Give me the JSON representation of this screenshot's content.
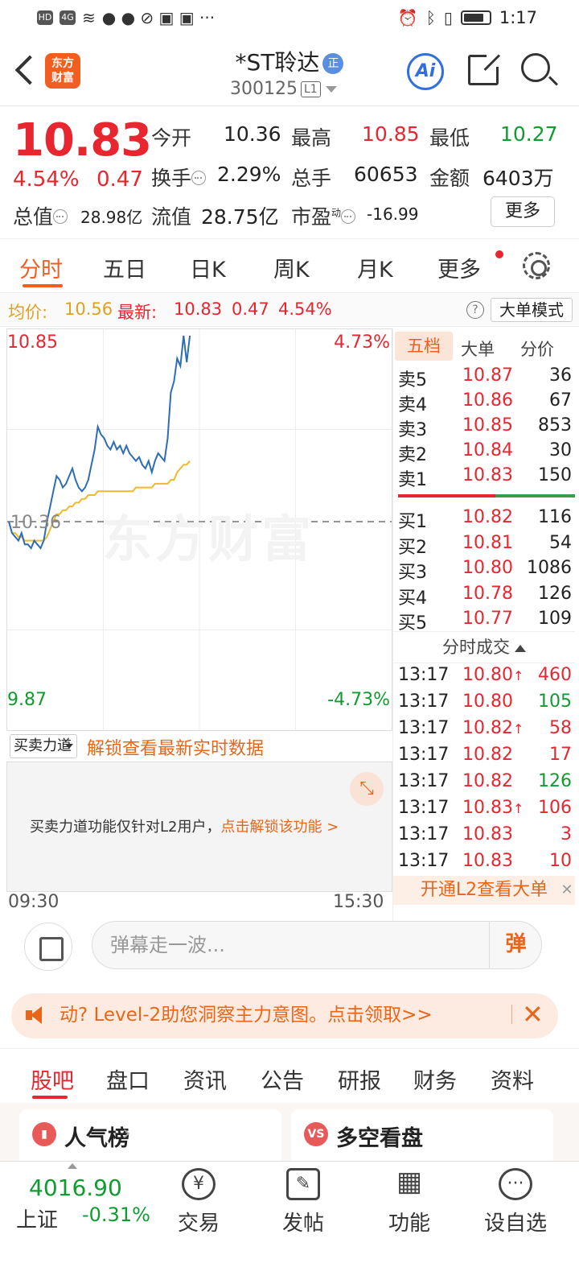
{
  "status_bar": {
    "time": "1:17",
    "left_icons": [
      "HD",
      "4G"
    ]
  },
  "header": {
    "logo_text_1": "东方",
    "logo_text_2": "财富",
    "stock_name": "*ST聆达",
    "badge": "正",
    "stock_code": "300125",
    "level": "L1",
    "ai_label": "Ai"
  },
  "quote": {
    "price": "10.83",
    "change_pct": "4.54%",
    "change": "0.47",
    "open_label": "今开",
    "open": "10.36",
    "high_label": "最高",
    "high": "10.85",
    "low_label": "最低",
    "low": "10.27",
    "turnover_label": "换手",
    "turnover": "2.29%",
    "volume_label": "总手",
    "volume": "60653",
    "amount_label": "金额",
    "amount": "6403万",
    "mktcap_label": "总值",
    "mktcap": "28.98亿",
    "float_label": "流值",
    "float": "28.75亿",
    "pe_label": "市盈",
    "pe_sup": "动",
    "pe": "-16.99",
    "more_label": "更多"
  },
  "chart_tabs": [
    "分时",
    "五日",
    "日K",
    "周K",
    "月K",
    "更多"
  ],
  "avg_bar": {
    "avg_label": "均价:",
    "avg_value": "10.56",
    "latest_label": "最新:",
    "latest_value": "10.83",
    "latest_change": "0.47",
    "latest_pct": "4.54%",
    "help": "?",
    "mode_button": "大单模式"
  },
  "chart_data": {
    "type": "line",
    "y_top_label": "10.85",
    "y_bottom_label": "9.87",
    "y_top_pct": "4.73%",
    "y_bottom_pct": "-4.73%",
    "ref_price_label": "10.36",
    "ylim": [
      9.87,
      10.85
    ],
    "ref_price": 10.36,
    "x_start": "09:30",
    "x_end": "15:30",
    "watermark": "东方财富",
    "series": [
      {
        "color": "#2d6db5",
        "values": [
          10.36,
          10.33,
          10.32,
          10.31,
          10.33,
          10.3,
          10.3,
          10.29,
          10.31,
          10.3,
          10.29,
          10.31,
          10.36,
          10.4,
          10.44,
          10.48,
          10.47,
          10.45,
          10.46,
          10.48,
          10.5,
          10.47,
          10.45,
          10.44,
          10.45,
          10.47,
          10.51,
          10.55,
          10.61,
          10.59,
          10.58,
          10.56,
          10.55,
          10.57,
          10.55,
          10.56,
          10.54,
          10.56,
          10.54,
          10.53,
          10.52,
          10.53,
          10.51,
          10.5,
          10.52,
          10.49,
          10.52,
          10.54,
          10.53,
          10.52,
          10.58,
          10.7,
          10.73,
          10.79,
          10.77,
          10.85,
          10.78,
          10.85
        ]
      },
      {
        "color": "#f0b92e",
        "values": [
          10.36,
          10.33,
          10.33,
          10.32,
          10.32,
          10.31,
          10.31,
          10.31,
          10.31,
          10.31,
          10.31,
          10.31,
          10.32,
          10.34,
          10.36,
          10.38,
          10.38,
          10.39,
          10.39,
          10.4,
          10.4,
          10.41,
          10.41,
          10.42,
          10.42,
          10.43,
          10.43,
          10.43,
          10.44,
          10.44,
          10.44,
          10.44,
          10.44,
          10.44,
          10.44,
          10.44,
          10.44,
          10.44,
          10.44,
          10.44,
          10.45,
          10.45,
          10.45,
          10.45,
          10.45,
          10.45,
          10.46,
          10.46,
          10.46,
          10.46,
          10.46,
          10.47,
          10.47,
          10.49,
          10.5,
          10.51,
          10.51,
          10.52
        ]
      }
    ]
  },
  "bs_bar": {
    "select_label": "买卖力道",
    "unlock_text": "解锁查看最新实时数据"
  },
  "l2_panel": {
    "message": "买卖力道功能仅针对L2用户，",
    "link": "点击解锁该功能 >"
  },
  "order_book": {
    "tabs": [
      "五档",
      "大单",
      "分价"
    ],
    "sells": [
      {
        "label": "卖5",
        "price": "10.87",
        "vol": "36"
      },
      {
        "label": "卖4",
        "price": "10.86",
        "vol": "67"
      },
      {
        "label": "卖3",
        "price": "10.85",
        "vol": "853"
      },
      {
        "label": "卖2",
        "price": "10.84",
        "vol": "30"
      },
      {
        "label": "卖1",
        "price": "10.83",
        "vol": "150"
      }
    ],
    "buys": [
      {
        "label": "买1",
        "price": "10.82",
        "vol": "116"
      },
      {
        "label": "买2",
        "price": "10.81",
        "vol": "54"
      },
      {
        "label": "买3",
        "price": "10.80",
        "vol": "1086"
      },
      {
        "label": "买4",
        "price": "10.78",
        "vol": "126"
      },
      {
        "label": "买5",
        "price": "10.77",
        "vol": "109"
      }
    ],
    "trades_title": "分时成交",
    "trades": [
      {
        "time": "13:17",
        "price": "10.80",
        "up": true,
        "vol": "460",
        "vol_color": "red"
      },
      {
        "time": "13:17",
        "price": "10.80",
        "up": false,
        "vol": "105",
        "vol_color": "green"
      },
      {
        "time": "13:17",
        "price": "10.82",
        "up": true,
        "vol": "58",
        "vol_color": "red"
      },
      {
        "time": "13:17",
        "price": "10.82",
        "up": false,
        "vol": "17",
        "vol_color": "red"
      },
      {
        "time": "13:17",
        "price": "10.82",
        "up": false,
        "vol": "126",
        "vol_color": "green"
      },
      {
        "time": "13:17",
        "price": "10.83",
        "up": true,
        "vol": "106",
        "vol_color": "red"
      },
      {
        "time": "13:17",
        "price": "10.83",
        "up": false,
        "vol": "3",
        "vol_color": "red"
      },
      {
        "time": "13:17",
        "price": "10.83",
        "up": false,
        "vol": "10",
        "vol_color": "red"
      }
    ],
    "open_l2": "开通L2查看大单",
    "close": "✕"
  },
  "danmu": {
    "placeholder": "弹幕走一波...",
    "button": "弹"
  },
  "banner": {
    "text": "动? Level-2助您洞察主力意图。点击领取>>",
    "close": "✕"
  },
  "sub_tabs": [
    "股吧",
    "盘口",
    "资讯",
    "公告",
    "研报",
    "财务",
    "资料"
  ],
  "cards": [
    {
      "label": "人气榜",
      "icon": "bar-chart-icon"
    },
    {
      "label": "多空看盘",
      "icon": "vs-icon",
      "icon_text": "VS"
    }
  ],
  "bottom_nav": {
    "index_value": "4016.90",
    "index_name": "上证",
    "index_change": "-0.31%",
    "items": [
      {
        "label": "交易",
        "glyph": "¥"
      },
      {
        "label": "发帖",
        "glyph": "✎"
      },
      {
        "label": "功能",
        "glyph": "▦"
      },
      {
        "label": "设自选",
        "glyph": "···"
      }
    ]
  }
}
